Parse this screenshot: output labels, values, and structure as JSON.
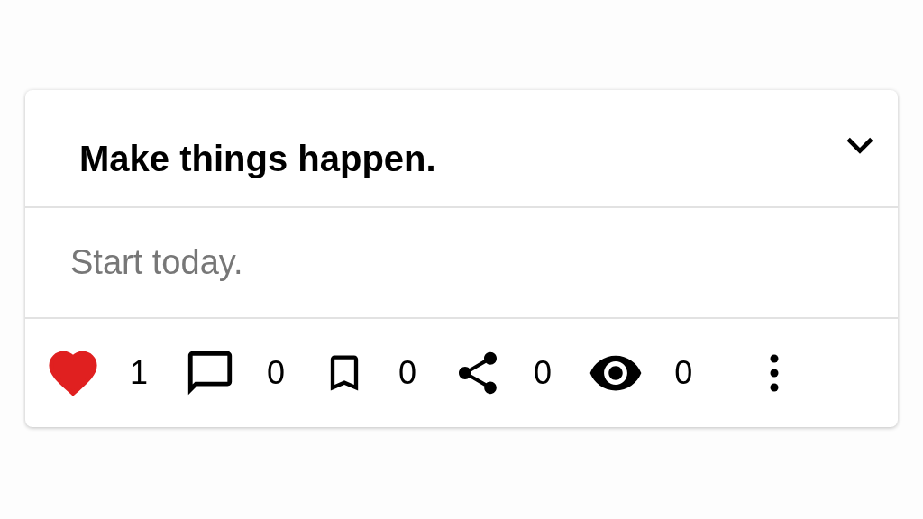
{
  "card": {
    "title": "Make things happen.",
    "expanded": true,
    "subtitle": "Start today.",
    "actions": [
      {
        "kind": "like",
        "count": "1",
        "selected": true
      },
      {
        "kind": "comment",
        "count": "0"
      },
      {
        "kind": "bookmark",
        "count": "0"
      },
      {
        "kind": "share",
        "count": "0"
      },
      {
        "kind": "views",
        "count": "0"
      }
    ]
  }
}
